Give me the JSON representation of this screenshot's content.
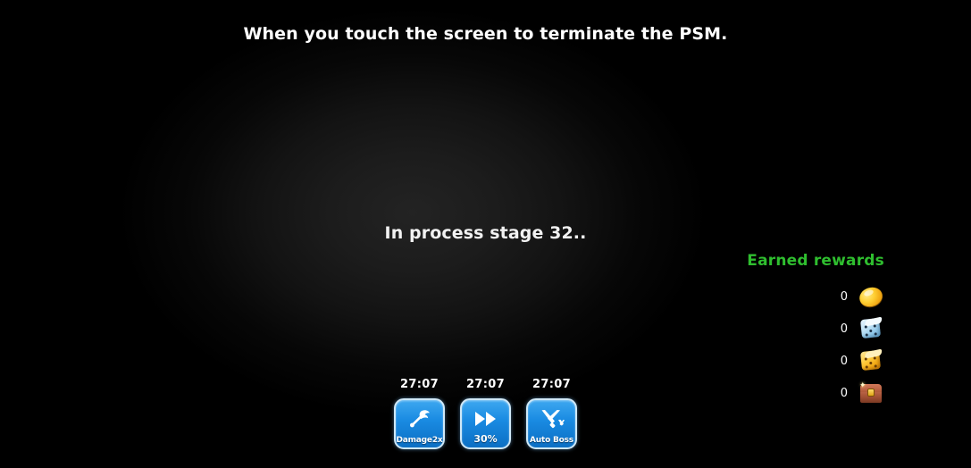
{
  "headline": "When you touch the screen to terminate the PSM.",
  "status": {
    "text": "In process stage 32.."
  },
  "rewards": {
    "title": "Earned rewards",
    "title_color": "#2fbe2f",
    "items": [
      {
        "count": "0",
        "icon": "gold-coin-icon"
      },
      {
        "count": "0",
        "icon": "blue-dice-icon"
      },
      {
        "count": "0",
        "icon": "gold-dice-icon"
      },
      {
        "count": "0",
        "icon": "treasure-chest-icon"
      }
    ]
  },
  "boosts": [
    {
      "timer": "27:07",
      "label": "Damage2x",
      "icon": "axe-icon"
    },
    {
      "timer": "27:07",
      "label": "30%",
      "icon": "fast-forward-icon"
    },
    {
      "timer": "27:07",
      "label": "Auto Boss",
      "icon": "crossed-swords-icon"
    }
  ],
  "colors": {
    "background": "#000000",
    "button_blue": "#1a8be2",
    "reward_green": "#2fbe2f",
    "text_white": "#ffffff"
  }
}
